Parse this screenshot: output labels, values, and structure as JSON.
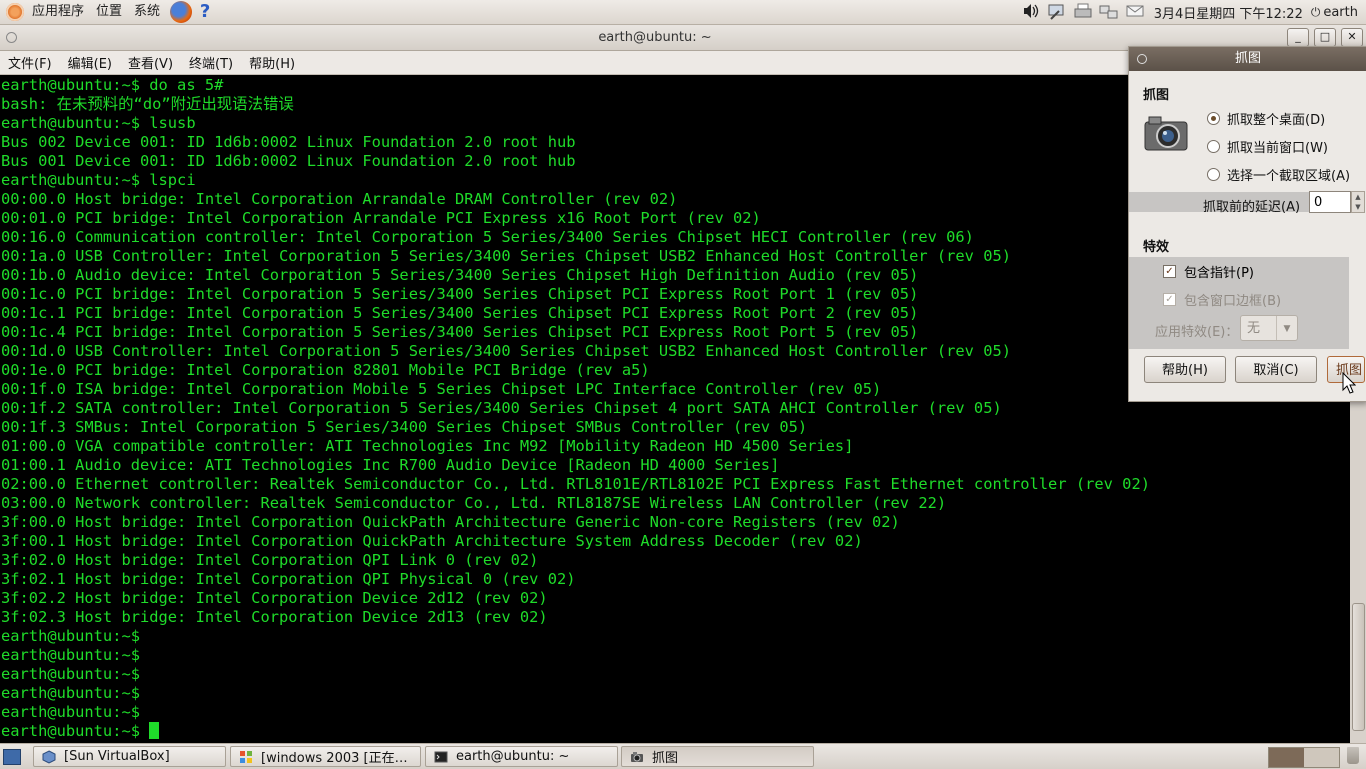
{
  "top_panel": {
    "applications": "应用程序",
    "places": "位置",
    "system": "系统",
    "help_icon_glyph": "?",
    "tray_icons": [
      "volume-icon",
      "network-tool-icon",
      "printer-icon",
      "network-icon",
      "mail-icon"
    ],
    "clock": "3月4日星期四 下午12:22",
    "user": "earth"
  },
  "terminal": {
    "title": "earth@ubuntu: ~",
    "window_buttons": {
      "minimize": "_",
      "maximize": "□",
      "close": "✕"
    },
    "menu": [
      "文件(F)",
      "编辑(E)",
      "查看(V)",
      "终端(T)",
      "帮助(H)"
    ],
    "lines": [
      "earth@ubuntu:~$ do as 5#",
      "bash: 在未预料的“do”附近出现语法错误",
      "earth@ubuntu:~$ lsusb",
      "Bus 002 Device 001: ID 1d6b:0002 Linux Foundation 2.0 root hub",
      "Bus 001 Device 001: ID 1d6b:0002 Linux Foundation 2.0 root hub",
      "earth@ubuntu:~$ lspci",
      "00:00.0 Host bridge: Intel Corporation Arrandale DRAM Controller (rev 02)",
      "00:01.0 PCI bridge: Intel Corporation Arrandale PCI Express x16 Root Port (rev 02)",
      "00:16.0 Communication controller: Intel Corporation 5 Series/3400 Series Chipset HECI Controller (rev 06)",
      "00:1a.0 USB Controller: Intel Corporation 5 Series/3400 Series Chipset USB2 Enhanced Host Controller (rev 05)",
      "00:1b.0 Audio device: Intel Corporation 5 Series/3400 Series Chipset High Definition Audio (rev 05)",
      "00:1c.0 PCI bridge: Intel Corporation 5 Series/3400 Series Chipset PCI Express Root Port 1 (rev 05)",
      "00:1c.1 PCI bridge: Intel Corporation 5 Series/3400 Series Chipset PCI Express Root Port 2 (rev 05)",
      "00:1c.4 PCI bridge: Intel Corporation 5 Series/3400 Series Chipset PCI Express Root Port 5 (rev 05)",
      "00:1d.0 USB Controller: Intel Corporation 5 Series/3400 Series Chipset USB2 Enhanced Host Controller (rev 05)",
      "00:1e.0 PCI bridge: Intel Corporation 82801 Mobile PCI Bridge (rev a5)",
      "00:1f.0 ISA bridge: Intel Corporation Mobile 5 Series Chipset LPC Interface Controller (rev 05)",
      "00:1f.2 SATA controller: Intel Corporation 5 Series/3400 Series Chipset 4 port SATA AHCI Controller (rev 05)",
      "00:1f.3 SMBus: Intel Corporation 5 Series/3400 Series Chipset SMBus Controller (rev 05)",
      "01:00.0 VGA compatible controller: ATI Technologies Inc M92 [Mobility Radeon HD 4500 Series]",
      "01:00.1 Audio device: ATI Technologies Inc R700 Audio Device [Radeon HD 4000 Series]",
      "02:00.0 Ethernet controller: Realtek Semiconductor Co., Ltd. RTL8101E/RTL8102E PCI Express Fast Ethernet controller (rev 02)",
      "03:00.0 Network controller: Realtek Semiconductor Co., Ltd. RTL8187SE Wireless LAN Controller (rev 22)",
      "3f:00.0 Host bridge: Intel Corporation QuickPath Architecture Generic Non-core Registers (rev 02)",
      "3f:00.1 Host bridge: Intel Corporation QuickPath Architecture System Address Decoder (rev 02)",
      "3f:02.0 Host bridge: Intel Corporation QPI Link 0 (rev 02)",
      "3f:02.1 Host bridge: Intel Corporation QPI Physical 0 (rev 02)",
      "3f:02.2 Host bridge: Intel Corporation Device 2d12 (rev 02)",
      "3f:02.3 Host bridge: Intel Corporation Device 2d13 (rev 02)",
      "earth@ubuntu:~$",
      "earth@ubuntu:~$",
      "earth@ubuntu:~$",
      "earth@ubuntu:~$",
      "earth@ubuntu:~$",
      "earth@ubuntu:~$ "
    ],
    "colors": {
      "foreground": "#1fdc2a",
      "background": "#000000"
    }
  },
  "screenshot_dialog": {
    "title": "抓图",
    "grab_header": "抓图",
    "options": [
      {
        "label": "抓取整个桌面(D)",
        "selected": true
      },
      {
        "label": "抓取当前窗口(W)",
        "selected": false
      },
      {
        "label": "选择一个截取区域(A)",
        "selected": false
      }
    ],
    "delay_label": "抓取前的延迟(A)",
    "delay_value": "0",
    "effects_header": "特效",
    "include_pointer": "包含指针(P)",
    "include_border": "包含窗口边框(B)",
    "apply_effect_label": "应用特效(E)：",
    "apply_effect_value": "无",
    "buttons": {
      "help": "帮助(H)",
      "cancel": "取消(C)",
      "grab": "抓图"
    }
  },
  "taskbar": {
    "items": [
      {
        "label": "[Sun VirtualBox]",
        "icon": "virtualbox-icon"
      },
      {
        "label": "[windows 2003 [正在…",
        "icon": "windows-icon"
      },
      {
        "label": "earth@ubuntu: ~",
        "icon": "terminal-icon"
      },
      {
        "label": "抓图",
        "icon": "camera-icon"
      }
    ]
  }
}
